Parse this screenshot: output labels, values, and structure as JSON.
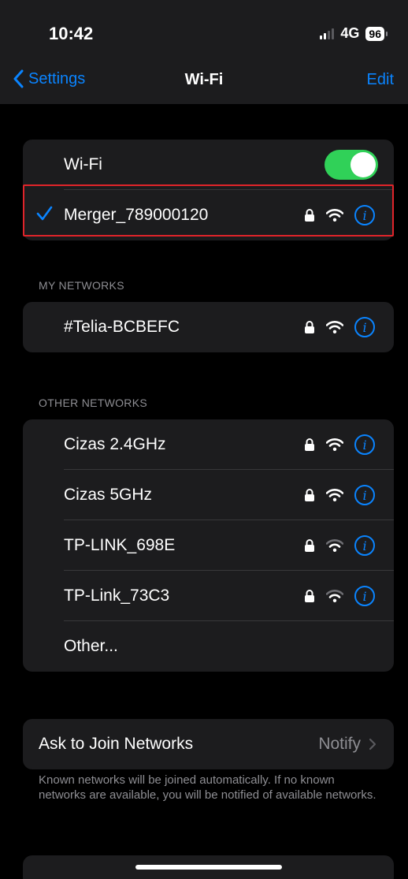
{
  "status_bar": {
    "time": "10:42",
    "network_type": "4G",
    "battery": "96",
    "signal_bars_active": 2,
    "signal_bars_total": 4
  },
  "nav": {
    "back_label": "Settings",
    "title": "Wi-Fi",
    "edit_label": "Edit"
  },
  "wifi": {
    "toggle_label": "Wi-Fi",
    "toggle_on": true,
    "connected_network": "Merger_789000120"
  },
  "sections": {
    "my_networks_header": "MY NETWORKS",
    "other_networks_header": "OTHER NETWORKS"
  },
  "my_networks": [
    {
      "name": "#Telia-BCBEFC",
      "locked": true,
      "signal": "full"
    }
  ],
  "other_networks": [
    {
      "name": "Cizas 2.4GHz",
      "locked": true,
      "signal": "full"
    },
    {
      "name": "Cizas 5GHz",
      "locked": true,
      "signal": "full"
    },
    {
      "name": "TP-LINK_698E",
      "locked": true,
      "signal": "weak"
    },
    {
      "name": "TP-Link_73C3",
      "locked": true,
      "signal": "weak"
    },
    {
      "name": "Other..."
    }
  ],
  "ask_to_join": {
    "label": "Ask to Join Networks",
    "value": "Notify",
    "footnote": "Known networks will be joined automatically. If no known networks are available, you will be notified of available networks."
  },
  "colors": {
    "accent": "#0a84ff",
    "toggle_on": "#30d158",
    "highlight": "#e0242a",
    "cell_bg": "#1c1c1e"
  },
  "icons": {
    "back": "chevron-left-icon",
    "lock": "lock-icon",
    "wifi": "wifi-icon",
    "info": "info-icon",
    "check": "checkmark-icon",
    "chevron": "chevron-right-icon"
  }
}
